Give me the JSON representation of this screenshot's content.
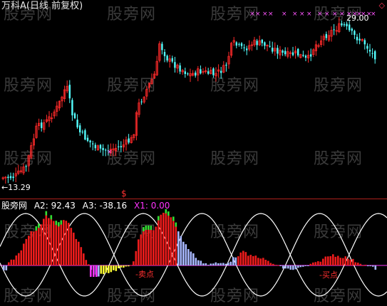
{
  "window": {
    "title": "万科A(日线 前复权)",
    "corner_icon": "diamond-icon"
  },
  "price_panel": {
    "high_label": "29.00",
    "low_label": "←13.29",
    "marker": "$",
    "colors": {
      "up": "#ff2a2a",
      "down": "#54ffff",
      "cross": "#ff55ff",
      "ma": "#ffffff"
    }
  },
  "indicator": {
    "name": "股旁网",
    "a2_label": "A2:",
    "a2_value": "92.43",
    "a3_label": "A3:",
    "a3_value": "-38.16",
    "x1_label": "X1:",
    "x1_value": "0.00",
    "buy_signal": "-卖点",
    "sell_signal": "-买点",
    "colors": {
      "red": "#ee1c1c",
      "green": "#33dd33",
      "blue": "#a8b8ff",
      "yellow": "#ffff33",
      "magenta": "#ff33ff",
      "sine": "#ffffff"
    }
  },
  "watermark": {
    "text": "股旁网"
  }
}
